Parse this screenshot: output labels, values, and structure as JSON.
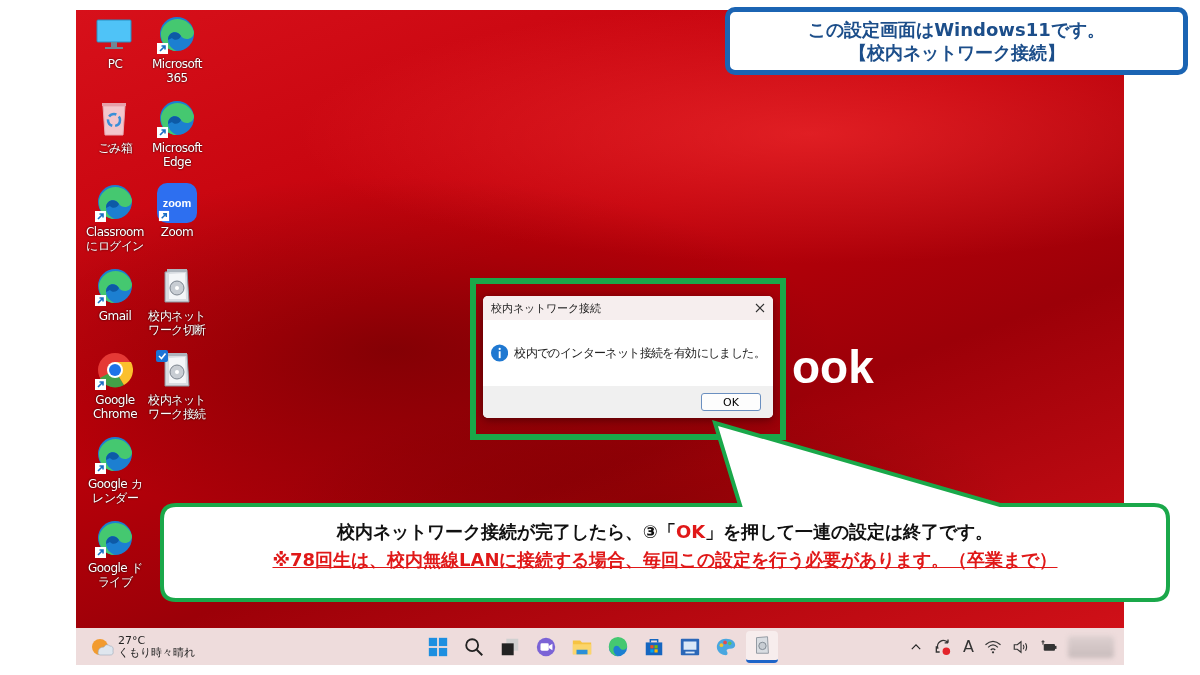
{
  "slide_note": {
    "lines": [
      "この設定画面はWindows11です。",
      "【校内ネットワーク接続】"
    ]
  },
  "desktop": {
    "wallpaper_text": "ook",
    "icons": [
      {
        "label": "PC",
        "kind": "pc",
        "shortcut": false,
        "selected": false
      },
      {
        "label": "ごみ箱",
        "kind": "recycle",
        "shortcut": false,
        "selected": false
      },
      {
        "label": "Classroom にログイン",
        "kind": "edge",
        "shortcut": true,
        "selected": false
      },
      {
        "label": "Gmail",
        "kind": "edge",
        "shortcut": true,
        "selected": false
      },
      {
        "label": "Google Chrome",
        "kind": "chrome",
        "shortcut": true,
        "selected": false
      },
      {
        "label": "Google カレンダー",
        "kind": "edge",
        "shortcut": true,
        "selected": false
      },
      {
        "label": "Google ドライブ",
        "kind": "edge",
        "shortcut": true,
        "selected": false
      },
      {
        "label": "Microsoft 365",
        "kind": "edge",
        "shortcut": true,
        "selected": false
      },
      {
        "label": "Microsoft Edge",
        "kind": "edge",
        "shortcut": true,
        "selected": false
      },
      {
        "label": "Zoom",
        "kind": "zoom",
        "logo_text": "zoom",
        "shortcut": true,
        "selected": false
      },
      {
        "label": "校内ネットワーク切断",
        "kind": "installer",
        "shortcut": false,
        "selected": false
      },
      {
        "label": "校内ネットワーク接続",
        "kind": "installer",
        "shortcut": false,
        "selected": true
      }
    ]
  },
  "dialog": {
    "title": "校内ネットワーク接続",
    "message": "校内でのインターネット接続を有効にしました。",
    "button": "OK"
  },
  "taskbar": {
    "weather": {
      "temperature": "27°C",
      "condition": "くもり時々晴れ"
    },
    "apps": [
      {
        "kind": "start",
        "active": false
      },
      {
        "kind": "search",
        "active": false
      },
      {
        "kind": "taskview",
        "active": false
      },
      {
        "kind": "chat",
        "active": false
      },
      {
        "kind": "folder",
        "active": false
      },
      {
        "kind": "edge",
        "active": false
      },
      {
        "kind": "store",
        "active": false
      },
      {
        "kind": "laptop",
        "active": false
      },
      {
        "kind": "palette",
        "active": false
      },
      {
        "kind": "installer",
        "active": true
      }
    ],
    "ime": "A"
  },
  "callout": {
    "lines": [
      {
        "kind": "normal",
        "segments": [
          {
            "text": "校内ネットワーク接続が完了したら、③「",
            "accent": false
          },
          {
            "text": "OK",
            "accent": true
          },
          {
            "text": "」を押して一連の設定は終了です。",
            "accent": false
          }
        ]
      },
      {
        "kind": "warning",
        "segments": [
          {
            "text": "※78回生は、校内無線LANに接続する場合、毎回この設定を行う必要があります。（卒業まで）"
          }
        ]
      }
    ]
  }
}
